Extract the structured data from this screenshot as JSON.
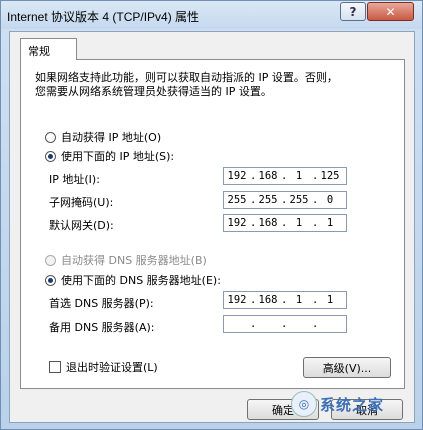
{
  "window": {
    "title": "Internet 协议版本 4 (TCP/IPv4) 属性",
    "help_label": "?",
    "close_label": "✕"
  },
  "tabs": [
    {
      "label": "常规"
    }
  ],
  "description_lines": [
    "如果网络支持此功能，则可以获取自动指派的 IP 设置。否则，",
    "您需要从网络系统管理员处获得适当的 IP 设置。"
  ],
  "ip_section": {
    "auto_label": "自动获得 IP 地址(O)",
    "manual_label": "使用下面的 IP 地址(S):",
    "selected": "manual",
    "ip_label": "IP 地址(I):",
    "ip_value": [
      "192",
      "168",
      "1",
      "125"
    ],
    "mask_label": "子网掩码(U):",
    "mask_value": [
      "255",
      "255",
      "255",
      "0"
    ],
    "gateway_label": "默认网关(D):",
    "gateway_value": [
      "192",
      "168",
      "1",
      "1"
    ]
  },
  "dns_section": {
    "auto_label": "自动获得 DNS 服务器地址(B)",
    "manual_label": "使用下面的 DNS 服务器地址(E):",
    "selected": "manual",
    "preferred_label": "首选 DNS 服务器(P):",
    "preferred_value": [
      "192",
      "168",
      "1",
      "1"
    ],
    "alternate_label": "备用 DNS 服务器(A):",
    "alternate_value": [
      "",
      "",
      "",
      ""
    ]
  },
  "footer": {
    "validate_label": "退出时验证设置(L)",
    "validate_checked": false,
    "advanced_label": "高级(V)...",
    "ok_label": "确定",
    "cancel_label": "取消"
  },
  "watermark": {
    "text": "系统之家"
  }
}
